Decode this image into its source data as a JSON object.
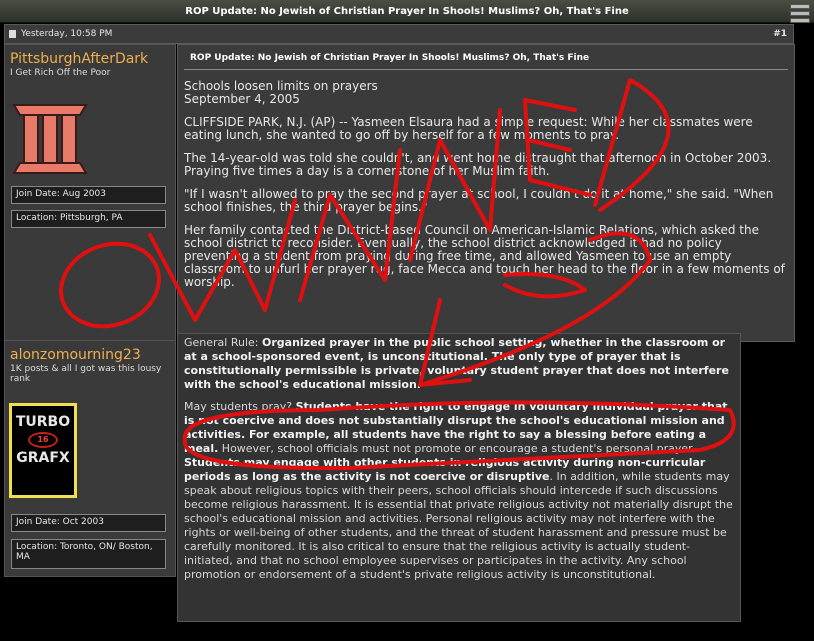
{
  "window": {
    "title": "ROP Update: No Jewish of Christian Prayer In Shools! Muslims? Oh, That's Fine"
  },
  "post_meta": {
    "timestamp": "Yesterday, 10:58 PM",
    "post_number": "#1"
  },
  "post1": {
    "username": "PittsburghAfterDark",
    "user_title": "I Get Rich Off the Poor",
    "join_date": "Join Date: Aug 2003",
    "location": "Location: Pittsburgh, PA",
    "title": "ROP Update: No Jewish of Christian Prayer In Shools! Muslims? Oh, That's Fine",
    "headline": "Schools loosen limits on prayers",
    "dateline": "September 4, 2005",
    "paragraphs": [
      "CLIFFSIDE PARK, N.J. (AP) -- Yasmeen Elsaura had a simple request: While her classmates were eating lunch, she wanted to go off by herself for a few moments to pray.",
      "The 14-year-old was told she couldn't, and went home distraught that afternoon in October 2003. Praying five times a day is a cornerstone of her Muslim faith.",
      "\"If I wasn't allowed to pray the second prayer at school, I couldn't do it at home,\" she said. \"When school finishes, the third prayer begins.\"",
      "Her family contacted the District-based Council on American-Islamic Relations, which asked the school district to reconsider. Eventually, the school district acknowledged it had no policy preventing a student from praying during free time, and allowed Yasmeen to use an empty classroom to unfurl her prayer rug, face Mecca and touch her head to the floor in a few moments of worship."
    ]
  },
  "post2": {
    "username": "alonzomourning23",
    "user_title": "1K posts & all I got was this lousy rank",
    "avatar_text_1": "TURBO",
    "avatar_badge": "16",
    "avatar_text_2": "GRAFX",
    "join_date": "Join Date: Oct 2003",
    "location": "Location: Toronto, ON/ Boston, MA",
    "p1_lead": "General Rule: ",
    "p1_bold": "Organized prayer in the public school setting, whether in the classroom or at a school-sponsored event, is unconstitutional. The only type of prayer that is constitutionally permissible is private, voluntary student prayer that does not interfere with the school's educational mission.",
    "p2_lead": "May students pray? ",
    "p2_bold1": "Students have the right to engage in voluntary individual prayer that is not coercive and does not substantially disrupt the school's educational mission and activities. For example, all students have the right to say a blessing before eating a meal.",
    "p2_normal1": " However, school officials must not promote or encourage a student's personal prayer. ",
    "p2_bold2": "Students may engage with other students in religious activity during non-curricular periods as long as the activity is not coercive or disruptive",
    "p2_normal2": ". In addition, while students may speak about religious topics with their peers, school officials should intercede if such discussions become religious harassment. It is essential that private religious activity not materially disrupt the school's educational mission and activities. Personal religious activity may not interfere with the rights or well-being of other students, and the threat of student harassment and pressure must be carefully monitored. It is also critical to ensure that the religious activity is actually student-initiated, and that no school employee supervises or participates in the activity. Any school promotion or endorsement of a student's private religious activity is unconstitutional."
  },
  "overlay": {
    "handwritten": "OWNED",
    "ink_color": "#e01010"
  },
  "colors": {
    "username": "#f0b050",
    "panel": "#3b3b3b",
    "background": "#000000"
  }
}
